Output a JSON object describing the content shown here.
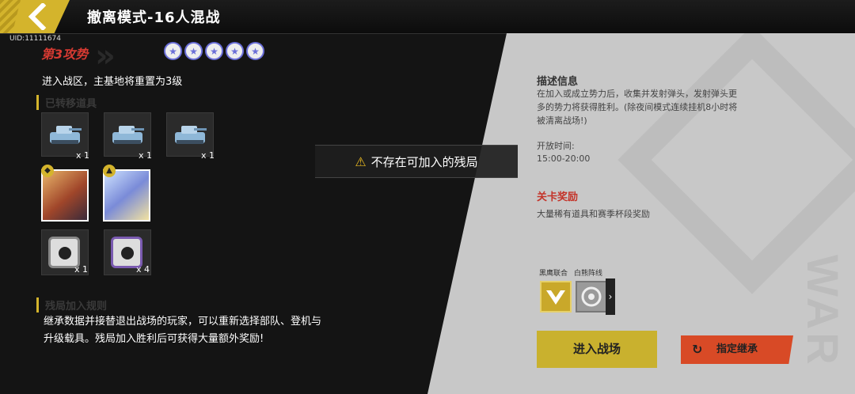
{
  "header": {
    "title": "撤离模式-16人混战",
    "uid": "UID:11111674"
  },
  "mode": {
    "wave": "第3攻势",
    "description": "进入战区，主基地将重置为3级",
    "stars": 5
  },
  "carried_items": {
    "title": "已转移道具",
    "tanks": [
      "x 1",
      "x 1",
      "x 1"
    ],
    "crates": [
      "x 1",
      "x 4"
    ]
  },
  "join_rules": {
    "title": "残局加入规则",
    "text": "继承数据并接替退出战场的玩家，可以重新选择部队、登机与升级载具。残局加入胜利后可获得大量额外奖励!"
  },
  "info": {
    "title": "描述信息",
    "text": "在加入或成立势力后，收集并发射弹头，发射弹头更多的势力将获得胜利。(除夜间模式连续挂机8小时将被清离战场!)",
    "open_label": "开放时间:",
    "open_time": "15:00-20:00"
  },
  "reward": {
    "title": "关卡奖励",
    "text": "大量稀有道具和赛季杯段奖励"
  },
  "factions": [
    {
      "label": "黑鹰联合"
    },
    {
      "label": "白熊阵线"
    }
  ],
  "buttons": {
    "enter": "进入战场",
    "assign": "指定继承"
  },
  "toast": {
    "text": "不存在可加入的残局"
  },
  "colors": {
    "accent": "#d4b42c",
    "danger": "#d63a32",
    "assign": "#d84a26"
  }
}
